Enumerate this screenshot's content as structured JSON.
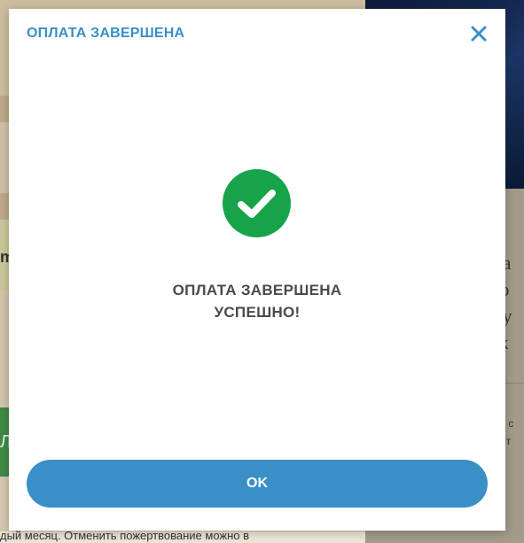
{
  "modal": {
    "title": "ОПЛАТА ЗАВЕРШЕНА",
    "message_line1": "ОПЛАТА ЗАВЕРШЕНА",
    "message_line2": "УСПЕШНО!",
    "ok_label": "OK",
    "close_icon": "close-icon",
    "success_icon": "check-circle-icon",
    "accent_color": "#3a8fc7",
    "success_color": "#16a34a"
  },
  "background": {
    "bottom_text": "дый месяц. Отменить пожертвование можно в",
    "left_fragment_m": "m",
    "left_fragment_green": "Л",
    "right_serif_lines": [
      "за",
      "ю",
      "ау",
      "ж"
    ],
    "right_small_lines": [
      "те с",
      "ист"
    ]
  }
}
